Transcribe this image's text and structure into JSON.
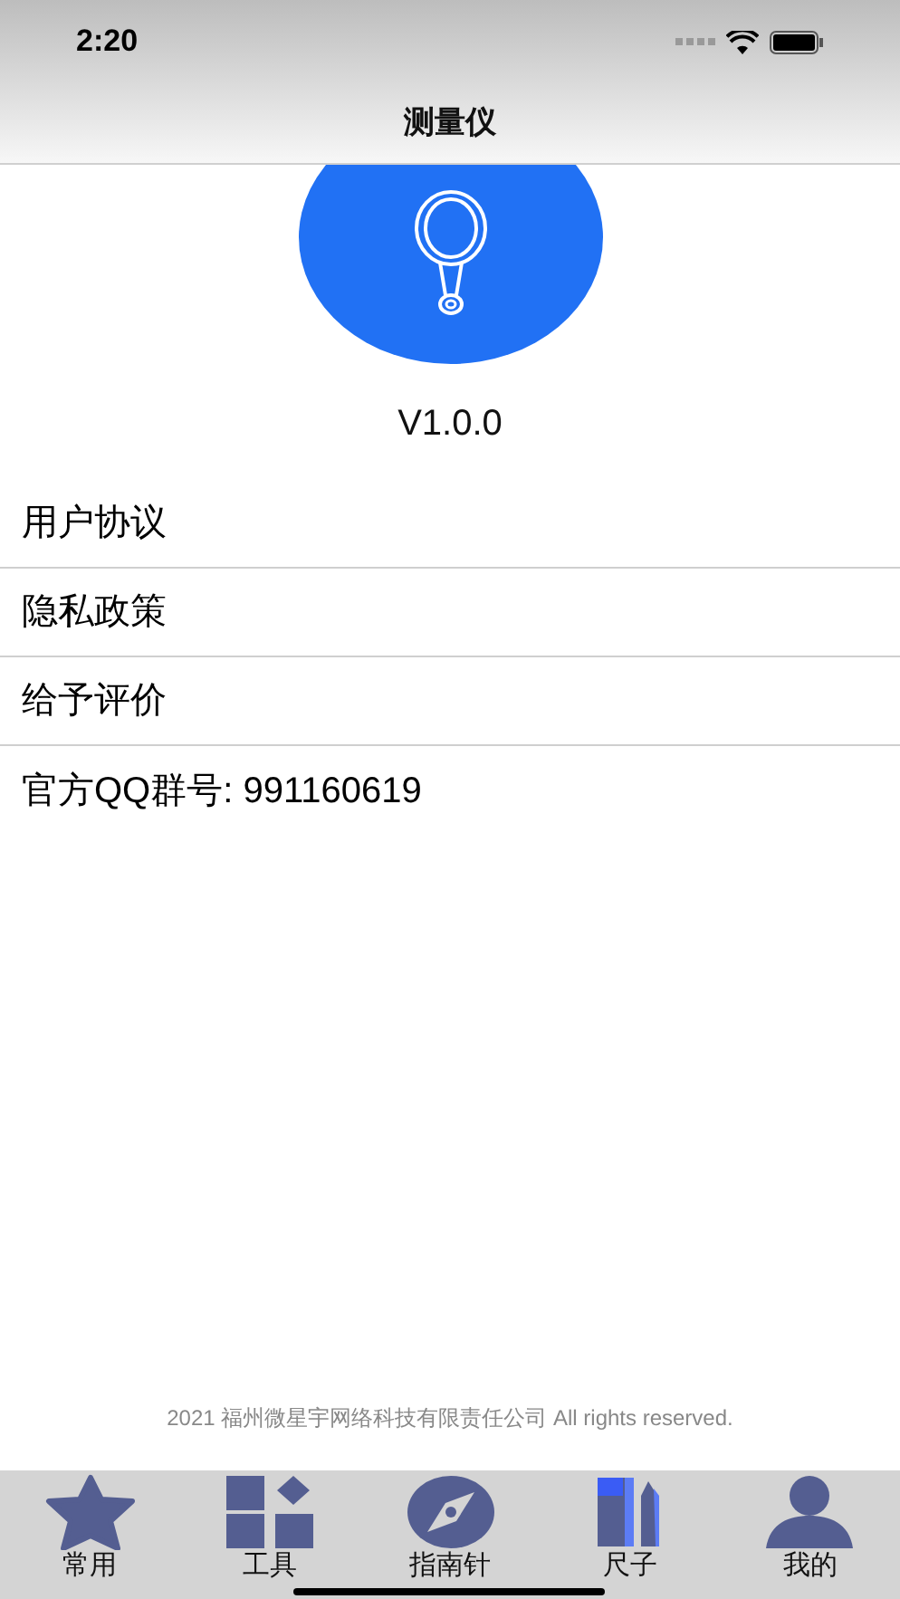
{
  "status_bar": {
    "time": "2:20"
  },
  "nav": {
    "title": "测量仪"
  },
  "version": "V1.0.0",
  "menu": [
    {
      "label": "用户协议"
    },
    {
      "label": "隐私政策"
    },
    {
      "label": "给予评价"
    },
    {
      "label": "官方QQ群号: 991160619"
    }
  ],
  "footer": "2021 福州微星宇网络科技有限责任公司 All rights reserved.",
  "tabs": [
    {
      "label": "常用",
      "kind": "star"
    },
    {
      "label": "工具",
      "kind": "grid"
    },
    {
      "label": "指南针",
      "kind": "compass"
    },
    {
      "label": "尺子",
      "kind": "ruler"
    },
    {
      "label": "我的",
      "kind": "person"
    }
  ]
}
